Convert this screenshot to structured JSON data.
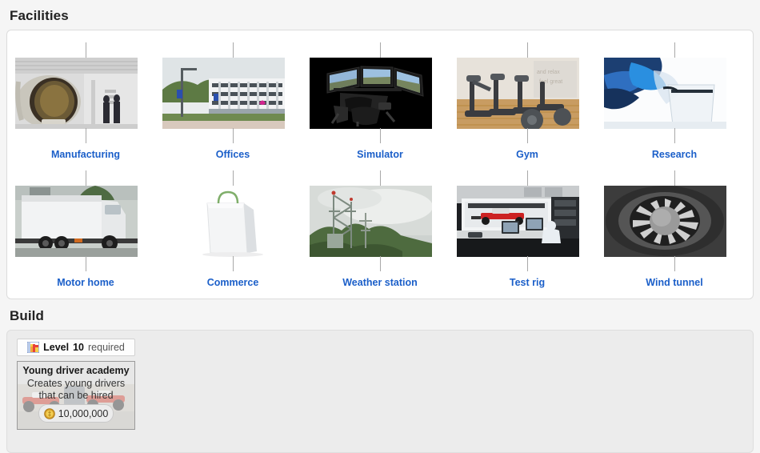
{
  "facilities_section": {
    "heading": "Facilities",
    "items": [
      {
        "label": "Manufacturing",
        "image": "autoclave-manufacturing-photo"
      },
      {
        "label": "Offices",
        "image": "office-building-photo"
      },
      {
        "label": "Simulator",
        "image": "racing-simulator-photo"
      },
      {
        "label": "Gym",
        "image": "gym-equipment-photo"
      },
      {
        "label": "Research",
        "image": "lab-beaker-pouring-photo"
      },
      {
        "label": "Motor home",
        "image": "white-truck-motorhome-photo"
      },
      {
        "label": "Commerce",
        "image": "shopping-bag-photo"
      },
      {
        "label": "Weather station",
        "image": "weather-mast-photo"
      },
      {
        "label": "Test rig",
        "image": "test-rig-control-room-photo"
      },
      {
        "label": "Wind tunnel",
        "image": "wind-tunnel-fan-photo"
      }
    ]
  },
  "build_section": {
    "heading": "Build",
    "requirement": {
      "icon": "chart-icon",
      "prefix": "Level",
      "level": "10",
      "suffix": "required",
      "text": "Level 10 required"
    },
    "card": {
      "title": "Young driver academy",
      "description": "Creates young drivers that can be hired",
      "price": "10,000,000",
      "price_icon": "coin-icon",
      "background": "formula-cars-race-photo"
    }
  },
  "colors": {
    "link": "#1b5fc9",
    "page_bg": "#f5f5f5",
    "panel_bg": "#ffffff",
    "panel_shaded_bg": "#ececec",
    "coin": "#e8b93a"
  }
}
